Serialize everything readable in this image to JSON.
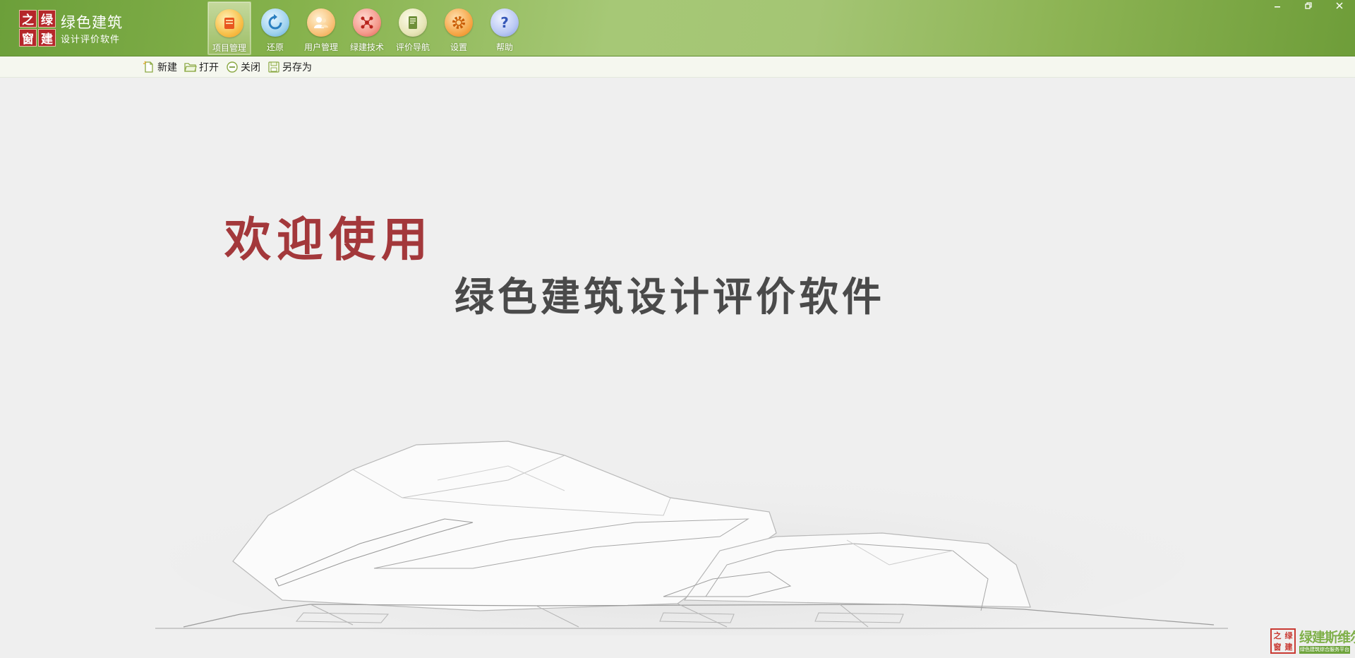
{
  "app": {
    "logo_chars": [
      "之",
      "绿",
      "窗",
      "建"
    ],
    "title": "绿色建筑",
    "subtitle": "设计评价软件"
  },
  "nav": [
    {
      "label": "项目管理",
      "icon": "project-management-icon",
      "active": true,
      "color": "#f5a623"
    },
    {
      "label": "还原",
      "icon": "restore-icon",
      "active": false,
      "color": "#5aa9d6"
    },
    {
      "label": "用户管理",
      "icon": "user-management-icon",
      "active": false,
      "color": "#f0a040"
    },
    {
      "label": "绿建技术",
      "icon": "green-tech-icon",
      "active": false,
      "color": "#e85a4f"
    },
    {
      "label": "评价导航",
      "icon": "evaluation-nav-icon",
      "active": false,
      "color": "#8aa24a"
    },
    {
      "label": "设置",
      "icon": "settings-icon",
      "active": false,
      "color": "#f08c1c"
    },
    {
      "label": "帮助",
      "icon": "help-icon",
      "active": false,
      "color": "#4a7fd6"
    }
  ],
  "window_controls": [
    "minimize-icon",
    "restore-window-icon",
    "close-icon"
  ],
  "toolbar": {
    "new_label": "新建",
    "open_label": "打开",
    "close_label": "关闭",
    "save_as_label": "另存为"
  },
  "content": {
    "welcome": "欢迎使用",
    "product_name": "绿色建筑设计评价软件"
  },
  "corner_logo": {
    "seal_chars": [
      "之",
      "绿",
      "窗",
      "建"
    ],
    "text": "绿建斯维尔",
    "subtext": "绿色建筑综合服务平台"
  },
  "colors": {
    "header_green": "#86b24c",
    "welcome_red": "#a3383b",
    "product_gray": "#4a4a4a",
    "background": "#efefef"
  }
}
